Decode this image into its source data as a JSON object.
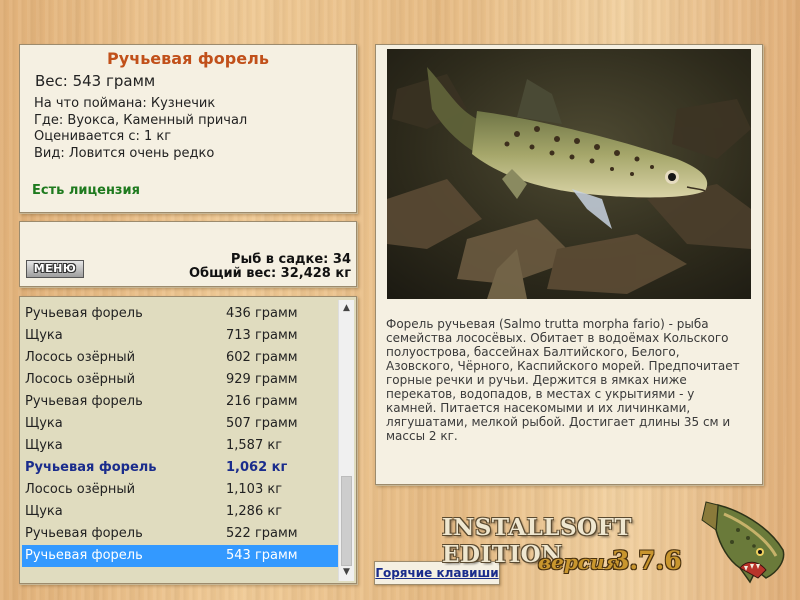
{
  "fish": {
    "title": "Ручьевая форель",
    "weight": "Вес: 543 грамм",
    "bait": "На что поймана: Кузнечик",
    "location": "Где: Вуокса, Каменный причал",
    "rated_from": "Оценивается с: 1 кг",
    "rarity": "Вид: Ловится очень редко",
    "license": "Есть лицензия"
  },
  "stats": {
    "menu_label": "МЕНЮ",
    "fish_count": "Рыб в садке: 34",
    "total_weight": "Общий вес: 32,428 кг"
  },
  "catch_list": [
    {
      "name": "Ручьевая форель",
      "weight": "436 грамм"
    },
    {
      "name": "Щука",
      "weight": "713 грамм"
    },
    {
      "name": "Лосось озёрный",
      "weight": "602 грамм"
    },
    {
      "name": "Лосось озёрный",
      "weight": "929 грамм"
    },
    {
      "name": "Ручьевая форель",
      "weight": "216 грамм"
    },
    {
      "name": "Щука",
      "weight": "507 грамм"
    },
    {
      "name": "Щука",
      "weight": "1,587 кг"
    },
    {
      "name": "Ручьевая форель",
      "weight": "1,062 кг"
    },
    {
      "name": "Лосось озёрный",
      "weight": "1,103 кг"
    },
    {
      "name": "Щука",
      "weight": "1,286 кг"
    },
    {
      "name": "Ручьевая форель",
      "weight": "522 грамм"
    },
    {
      "name": "Ручьевая форель",
      "weight": "543 грамм"
    }
  ],
  "description": "Форель ручьевая (Salmo trutta morpha fario) - рыба семейства лососёвых. Обитает в водоёмах Кольского полуострова, бассейнах Балтийского, Белого, Азовского, Чёрного, Каспийского морей. Предпочитает горные речки и ручьи. Держится в ямках ниже перекатов, водопадов, в местах с укрытиями - у камней. Питается насекомыми и их личинками, лягушатами, мелкой рыбой. Достигает длины 35 см и массы 2 кг.",
  "hotkeys_label": "Горячие клавиши",
  "brand": {
    "edition": "INSTALLSOFT EDITION",
    "version_word": "версия",
    "version_number": "3.7.6"
  },
  "colors": {
    "title": "#c1501a",
    "license": "#1e7a1e",
    "highlight_text": "#1a2c8c",
    "selection": "#3399ff",
    "brand_gold": "#c9962e"
  },
  "icons": {
    "scroll_up": "chevron-up-icon",
    "scroll_down": "chevron-down-icon",
    "logo": "pike-fish-logo"
  }
}
